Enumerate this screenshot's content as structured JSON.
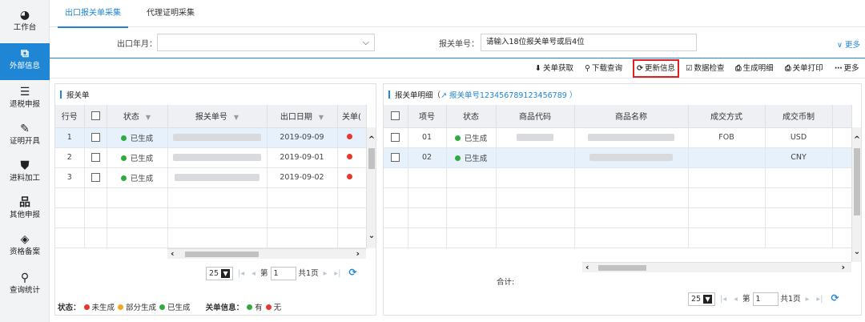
{
  "sidebar": {
    "items": [
      {
        "label": "工作台",
        "icon": "dashboard-icon",
        "glyph": "◕"
      },
      {
        "label": "外部信息",
        "icon": "external-info-icon",
        "glyph": "⧉",
        "active": true
      },
      {
        "label": "退税申报",
        "icon": "document-icon",
        "glyph": "☰"
      },
      {
        "label": "证明开具",
        "icon": "edit-icon",
        "glyph": "✎"
      },
      {
        "label": "进料加工",
        "icon": "shield-icon",
        "glyph": "⛊"
      },
      {
        "label": "其他申报",
        "icon": "org-chart-icon",
        "glyph": "品"
      },
      {
        "label": "资格备案",
        "icon": "cube-icon",
        "glyph": "◈"
      },
      {
        "label": "查询统计",
        "icon": "search-icon",
        "glyph": "⚲"
      }
    ]
  },
  "tabs": [
    "出口报关单采集",
    "代理证明采集"
  ],
  "filters": {
    "month_label": "出口年月：",
    "month_value": "",
    "decl_label": "报关单号：",
    "decl_placeholder": "请输入18位报关单号或后4位",
    "more": "∨ 更多"
  },
  "toolbar": [
    {
      "icon": "download-icon",
      "glyph": "⬇",
      "label": "关单获取"
    },
    {
      "icon": "search-icon",
      "glyph": "⚲",
      "label": "下载查询"
    },
    {
      "icon": "refresh-icon",
      "glyph": "⟳",
      "label": "更新信息",
      "highlight": true
    },
    {
      "icon": "check-icon",
      "glyph": "☑",
      "label": "数据检查"
    },
    {
      "icon": "print-icon",
      "glyph": "⎙",
      "label": "生成明细"
    },
    {
      "icon": "print-icon",
      "glyph": "⎙",
      "label": "关单打印"
    },
    {
      "icon": "more-icon",
      "glyph": "⋯",
      "label": "更多"
    }
  ],
  "left_panel": {
    "title": "报关单",
    "columns": [
      "行号",
      "",
      "状态",
      "报关单号",
      "出口日期",
      "关单("
    ],
    "rows": [
      {
        "no": "1",
        "status": "已生成",
        "date": "2019-09-09",
        "selected": true
      },
      {
        "no": "2",
        "status": "已生成",
        "date": "2019-09-01"
      },
      {
        "no": "3",
        "status": "已生成",
        "date": "2019-09-02"
      }
    ],
    "pager": {
      "page_size": "25",
      "page_label": "第",
      "page": "1",
      "total": "共1页"
    }
  },
  "right_panel": {
    "title": "报关单明细（",
    "title_link": " 报关单号123456789123456789 ）",
    "columns": [
      "",
      "项号",
      "状态",
      "商品代码",
      "商品名称",
      "成交方式",
      "成交币制"
    ],
    "rows": [
      {
        "item": "01",
        "status": "已生成",
        "trade": "FOB",
        "currency": "USD"
      },
      {
        "item": "02",
        "status": "已生成",
        "trade": "",
        "currency": "CNY"
      }
    ],
    "sum_label": "合计:",
    "pager": {
      "page_size": "25",
      "page_label": "第",
      "page": "1",
      "total": "共1页"
    }
  },
  "legend": {
    "status_key": "状态：",
    "status_items": [
      {
        "label": "未生成",
        "color": "#e8382d"
      },
      {
        "label": "部分生成",
        "color": "#f5a623"
      },
      {
        "label": "已生成",
        "color": "#2dab3f"
      }
    ],
    "info_key": "关单信息：",
    "info_items": [
      {
        "label": "有",
        "color": "#2dab3f"
      },
      {
        "label": "无",
        "color": "#e8382d"
      }
    ]
  },
  "colors": {
    "accent": "#1f86d6",
    "generated": "#2dab3f",
    "missing": "#e8382d",
    "highlight_border": "#e02020"
  }
}
